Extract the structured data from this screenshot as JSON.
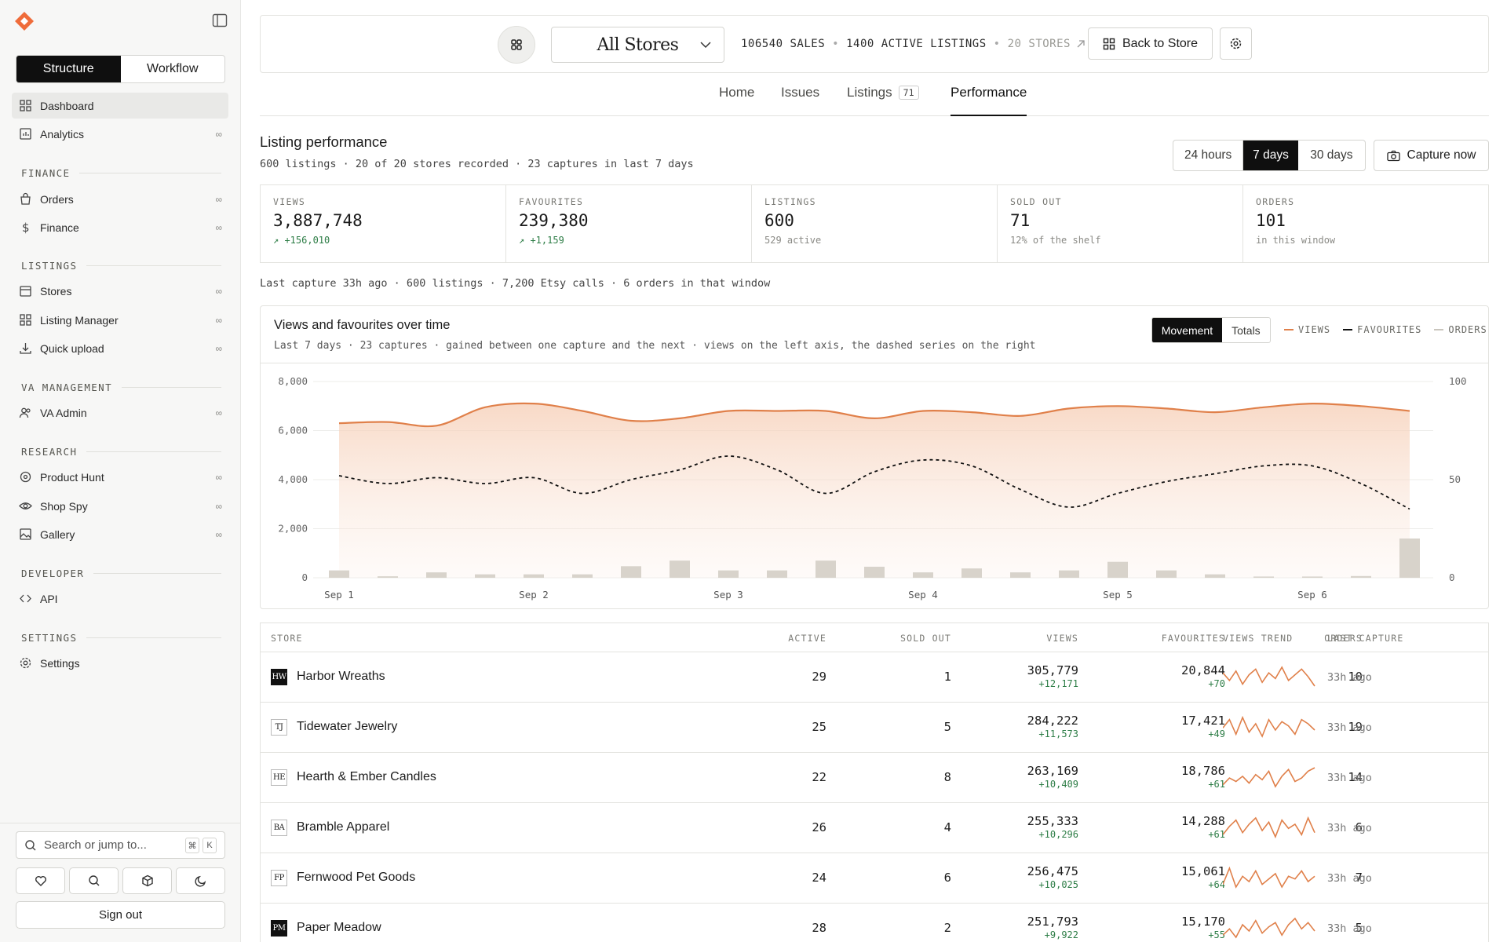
{
  "sidebar": {
    "segments": [
      "Structure",
      "Workflow"
    ],
    "items": [
      {
        "label": "Dashboard",
        "icon": "grid-icon"
      },
      {
        "label": "Analytics",
        "icon": "chart-icon",
        "badge": "∞"
      }
    ],
    "sections": [
      {
        "title": "FINANCE",
        "items": [
          {
            "label": "Orders",
            "icon": "bag-icon",
            "badge": "∞"
          },
          {
            "label": "Finance",
            "icon": "dollar-icon",
            "badge": "∞"
          }
        ]
      },
      {
        "title": "LISTINGS",
        "items": [
          {
            "label": "Stores",
            "icon": "store-icon",
            "badge": "∞"
          },
          {
            "label": "Listing Manager",
            "icon": "grid-icon",
            "badge": "∞"
          },
          {
            "label": "Quick upload",
            "icon": "download-icon",
            "badge": "∞"
          }
        ]
      },
      {
        "title": "VA MANAGEMENT",
        "items": [
          {
            "label": "VA Admin",
            "icon": "users-icon",
            "badge": "∞"
          }
        ]
      },
      {
        "title": "RESEARCH",
        "items": [
          {
            "label": "Product Hunt",
            "icon": "target-icon",
            "badge": "∞"
          },
          {
            "label": "Shop Spy",
            "icon": "eye-icon",
            "badge": "∞"
          },
          {
            "label": "Gallery",
            "icon": "image-icon",
            "badge": "∞"
          }
        ]
      },
      {
        "title": "DEVELOPER",
        "items": [
          {
            "label": "API",
            "icon": "code-icon"
          }
        ]
      },
      {
        "title": "SETTINGS",
        "items": [
          {
            "label": "Settings",
            "icon": "gear-icon"
          }
        ]
      }
    ],
    "search_placeholder": "Search or jump to...",
    "kbd": [
      "⌘",
      "K"
    ],
    "sign_out": "Sign out"
  },
  "topbar": {
    "store": "All Stores",
    "sales": "106540 SALES",
    "active": "1400 ACTIVE LISTINGS",
    "stores": "20 STORES",
    "back": "Back to Store"
  },
  "tabs": [
    {
      "label": "Home"
    },
    {
      "label": "Issues"
    },
    {
      "label": "Listings",
      "badge": "71"
    },
    {
      "label": "Performance"
    }
  ],
  "performance": {
    "title": "Listing performance",
    "subtitle": "600 listings · 20 of 20 stores recorded · 23 captures in last 7 days",
    "ranges": [
      "24 hours",
      "7 days",
      "30 days"
    ],
    "capture": "Capture now",
    "kpis": [
      {
        "label": "VIEWS",
        "value": "3,887,748",
        "delta": "↗ +156,010"
      },
      {
        "label": "FAVOURITES",
        "value": "239,380",
        "delta": "↗ +1,159"
      },
      {
        "label": "LISTINGS",
        "value": "600",
        "note": "529 active"
      },
      {
        "label": "SOLD OUT",
        "value": "71",
        "note": "12% of the shelf"
      },
      {
        "label": "ORDERS",
        "value": "101",
        "note": "in this window"
      }
    ],
    "last_line": "Last capture 33h ago · 600 listings · 7,200 Etsy calls · 6 orders in that window"
  },
  "chart_card": {
    "title": "Views and favourites over time",
    "subtitle": "Last 7 days · 23 captures · gained between one capture and the next · views on the left axis, the dashed series on the right",
    "toggle": [
      "Movement",
      "Totals"
    ],
    "legend": [
      "VIEWS",
      "FAVOURITES",
      "ORDERS"
    ]
  },
  "colors": {
    "views": "#e0804a",
    "area": "#f9e0d2",
    "orders_bar": "#d8d3cb",
    "accent_dark": "#0f0f0f",
    "positive": "#2d7d46"
  },
  "chart_data": {
    "type": "line",
    "x": [
      "Sep 1",
      "",
      "",
      "",
      "Sep 2",
      "",
      "",
      "",
      "Sep 3",
      "",
      "",
      "",
      "Sep 4",
      "",
      "",
      "",
      "Sep 5",
      "",
      "",
      "",
      "Sep 6",
      "",
      ""
    ],
    "x_ticks": [
      "Sep 1",
      "Sep 2",
      "Sep 3",
      "Sep 4",
      "Sep 5",
      "Sep 6"
    ],
    "y_left_ticks": [
      "8,000",
      "6,000",
      "4,000",
      "2,000",
      "0"
    ],
    "y_right_ticks": [
      "100",
      "50",
      "0"
    ],
    "y_left_range": [
      0,
      8000
    ],
    "y_right_range": [
      0,
      100
    ],
    "series": [
      {
        "name": "VIEWS",
        "axis": "left",
        "values": [
          6300,
          6350,
          6200,
          6950,
          7100,
          6800,
          6400,
          6500,
          6800,
          6800,
          6800,
          6500,
          6800,
          6750,
          6600,
          6900,
          7000,
          6900,
          6750,
          6950,
          7100,
          7000,
          6800
        ]
      },
      {
        "name": "FAVOURITES",
        "axis": "right",
        "values": [
          52,
          48,
          51,
          48,
          51,
          43,
          50,
          55,
          62,
          55,
          43,
          54,
          60,
          57,
          45,
          36,
          43,
          49,
          53,
          57,
          57,
          48,
          35
        ]
      },
      {
        "name": "ORDERS",
        "axis": "left",
        "values": [
          300,
          60,
          220,
          140,
          140,
          140,
          470,
          700,
          300,
          300,
          700,
          450,
          220,
          380,
          220,
          300,
          650,
          300,
          140,
          50,
          50,
          70,
          1600
        ]
      }
    ],
    "grid": true,
    "legend_position": "top-right"
  },
  "table": {
    "headers": [
      "STORE",
      "ACTIVE",
      "SOLD OUT",
      "VIEWS",
      "FAVOURITES",
      "ORDERS",
      "VIEWS TREND",
      "LAST CAPTURE"
    ],
    "rows": [
      {
        "logo": "HW",
        "dark": true,
        "store": "Harbor Wreaths",
        "active": "29",
        "sold_out": "1",
        "views": "305,779",
        "views_delta": "+12,171",
        "favs": "20,844",
        "favs_delta": "+70",
        "orders": "10",
        "last": "33h ago",
        "trend": [
          10,
          6,
          11,
          4,
          9,
          12,
          5,
          10,
          7,
          13,
          6,
          9,
          12,
          8,
          3
        ]
      },
      {
        "logo": "TJ",
        "dark": false,
        "store": "Tidewater Jewelry",
        "active": "25",
        "sold_out": "5",
        "views": "284,222",
        "views_delta": "+11,573",
        "favs": "17,421",
        "favs_delta": "+49",
        "orders": "19",
        "last": "33h ago",
        "trend": [
          8,
          12,
          5,
          13,
          6,
          10,
          4,
          12,
          7,
          11,
          9,
          5,
          12,
          10,
          7
        ]
      },
      {
        "logo": "HE",
        "dark": false,
        "store": "Hearth & Ember Candles",
        "active": "22",
        "sold_out": "8",
        "views": "263,169",
        "views_delta": "+10,409",
        "favs": "18,786",
        "favs_delta": "+61",
        "orders": "14",
        "last": "33h ago",
        "trend": [
          4,
          8,
          6,
          9,
          5,
          10,
          7,
          12,
          3,
          9,
          13,
          6,
          8,
          12,
          14
        ]
      },
      {
        "logo": "BA",
        "dark": false,
        "store": "Bramble Apparel",
        "active": "26",
        "sold_out": "4",
        "views": "255,333",
        "views_delta": "+10,296",
        "favs": "14,288",
        "favs_delta": "+61",
        "orders": "6",
        "last": "33h ago",
        "trend": [
          5,
          9,
          12,
          6,
          10,
          13,
          7,
          11,
          4,
          12,
          8,
          10,
          5,
          13,
          6
        ]
      },
      {
        "logo": "FP",
        "dark": false,
        "store": "Fernwood Pet Goods",
        "active": "24",
        "sold_out": "6",
        "views": "256,475",
        "views_delta": "+10,025",
        "favs": "15,061",
        "favs_delta": "+64",
        "orders": "7",
        "last": "33h ago",
        "trend": [
          6,
          12,
          5,
          9,
          7,
          11,
          6,
          8,
          10,
          5,
          9,
          8,
          11,
          7,
          9
        ]
      },
      {
        "logo": "PM",
        "dark": true,
        "store": "Paper Meadow",
        "active": "28",
        "sold_out": "2",
        "views": "251,793",
        "views_delta": "+9,922",
        "favs": "15,170",
        "favs_delta": "+55",
        "orders": "5",
        "last": "33h ago",
        "trend": [
          5,
          8,
          4,
          10,
          7,
          12,
          6,
          9,
          11,
          5,
          10,
          13,
          8,
          11,
          7
        ]
      }
    ]
  }
}
